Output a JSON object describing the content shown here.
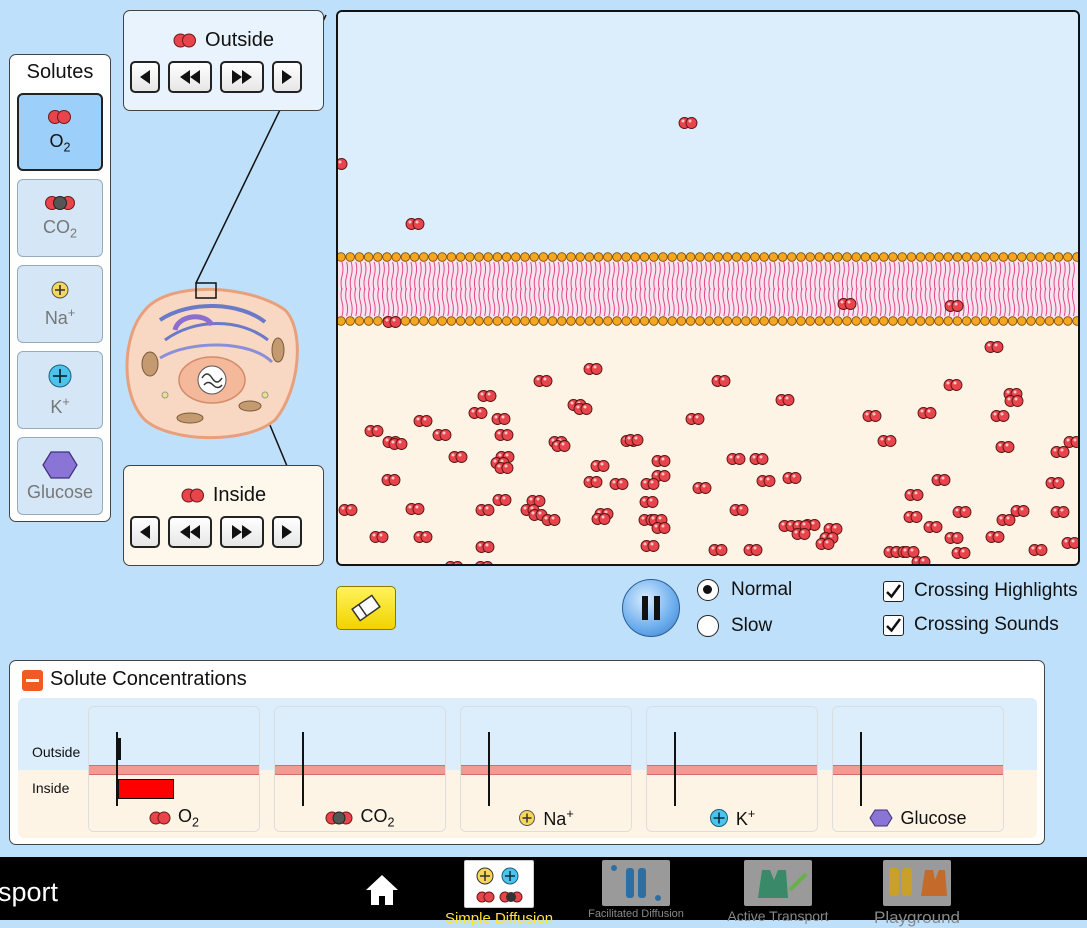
{
  "solutes": {
    "title": "Solutes",
    "items": [
      {
        "name": "O",
        "sub": "2",
        "sup": "",
        "selected": true
      },
      {
        "name": "CO",
        "sub": "2",
        "sup": "",
        "selected": false
      },
      {
        "name": "Na",
        "sub": "",
        "sup": "+",
        "selected": false
      },
      {
        "name": "K",
        "sub": "",
        "sup": "+",
        "selected": false
      },
      {
        "name": "Glucose",
        "sub": "",
        "sup": "",
        "selected": false
      }
    ]
  },
  "outside_control": {
    "label": "Outside"
  },
  "inside_control": {
    "label": "Inside"
  },
  "speed": {
    "normal": "Normal",
    "slow": "Slow",
    "selected": "normal"
  },
  "options": {
    "crossing_highlights": "Crossing Highlights",
    "crossing_sounds": "Crossing Sounds",
    "highlights_checked": true,
    "sounds_checked": true
  },
  "concentrations": {
    "title": "Solute Concentrations",
    "outside_label": "Outside",
    "inside_label": "Inside",
    "gauges": [
      {
        "name": "O",
        "sub": "2",
        "sup": "",
        "outside_level": 0.01,
        "inside_level": 0.4
      },
      {
        "name": "CO",
        "sub": "2",
        "sup": "",
        "outside_level": 0,
        "inside_level": 0
      },
      {
        "name": "Na",
        "sub": "",
        "sup": "+",
        "outside_level": 0,
        "inside_level": 0
      },
      {
        "name": "K",
        "sub": "",
        "sup": "+",
        "outside_level": 0,
        "inside_level": 0
      },
      {
        "name": "Glucose",
        "sub": "",
        "sup": "",
        "outside_level": 0,
        "inside_level": 0
      }
    ]
  },
  "nav": {
    "app_title": "sport",
    "items": [
      {
        "label": "Simple Diffusion",
        "selected": true
      },
      {
        "label": "Facilitated Diffusion",
        "selected": false
      },
      {
        "label": "Active Transport",
        "selected": false
      },
      {
        "label": "Playground",
        "selected": false
      }
    ]
  },
  "colors": {
    "o2": "#e8444b",
    "membrane_head": "#f5a623",
    "membrane_tail": "#e0488a",
    "outside_bg": "#dcedfc",
    "inside_bg": "#fdf4e6",
    "accent": "#f05a23"
  }
}
